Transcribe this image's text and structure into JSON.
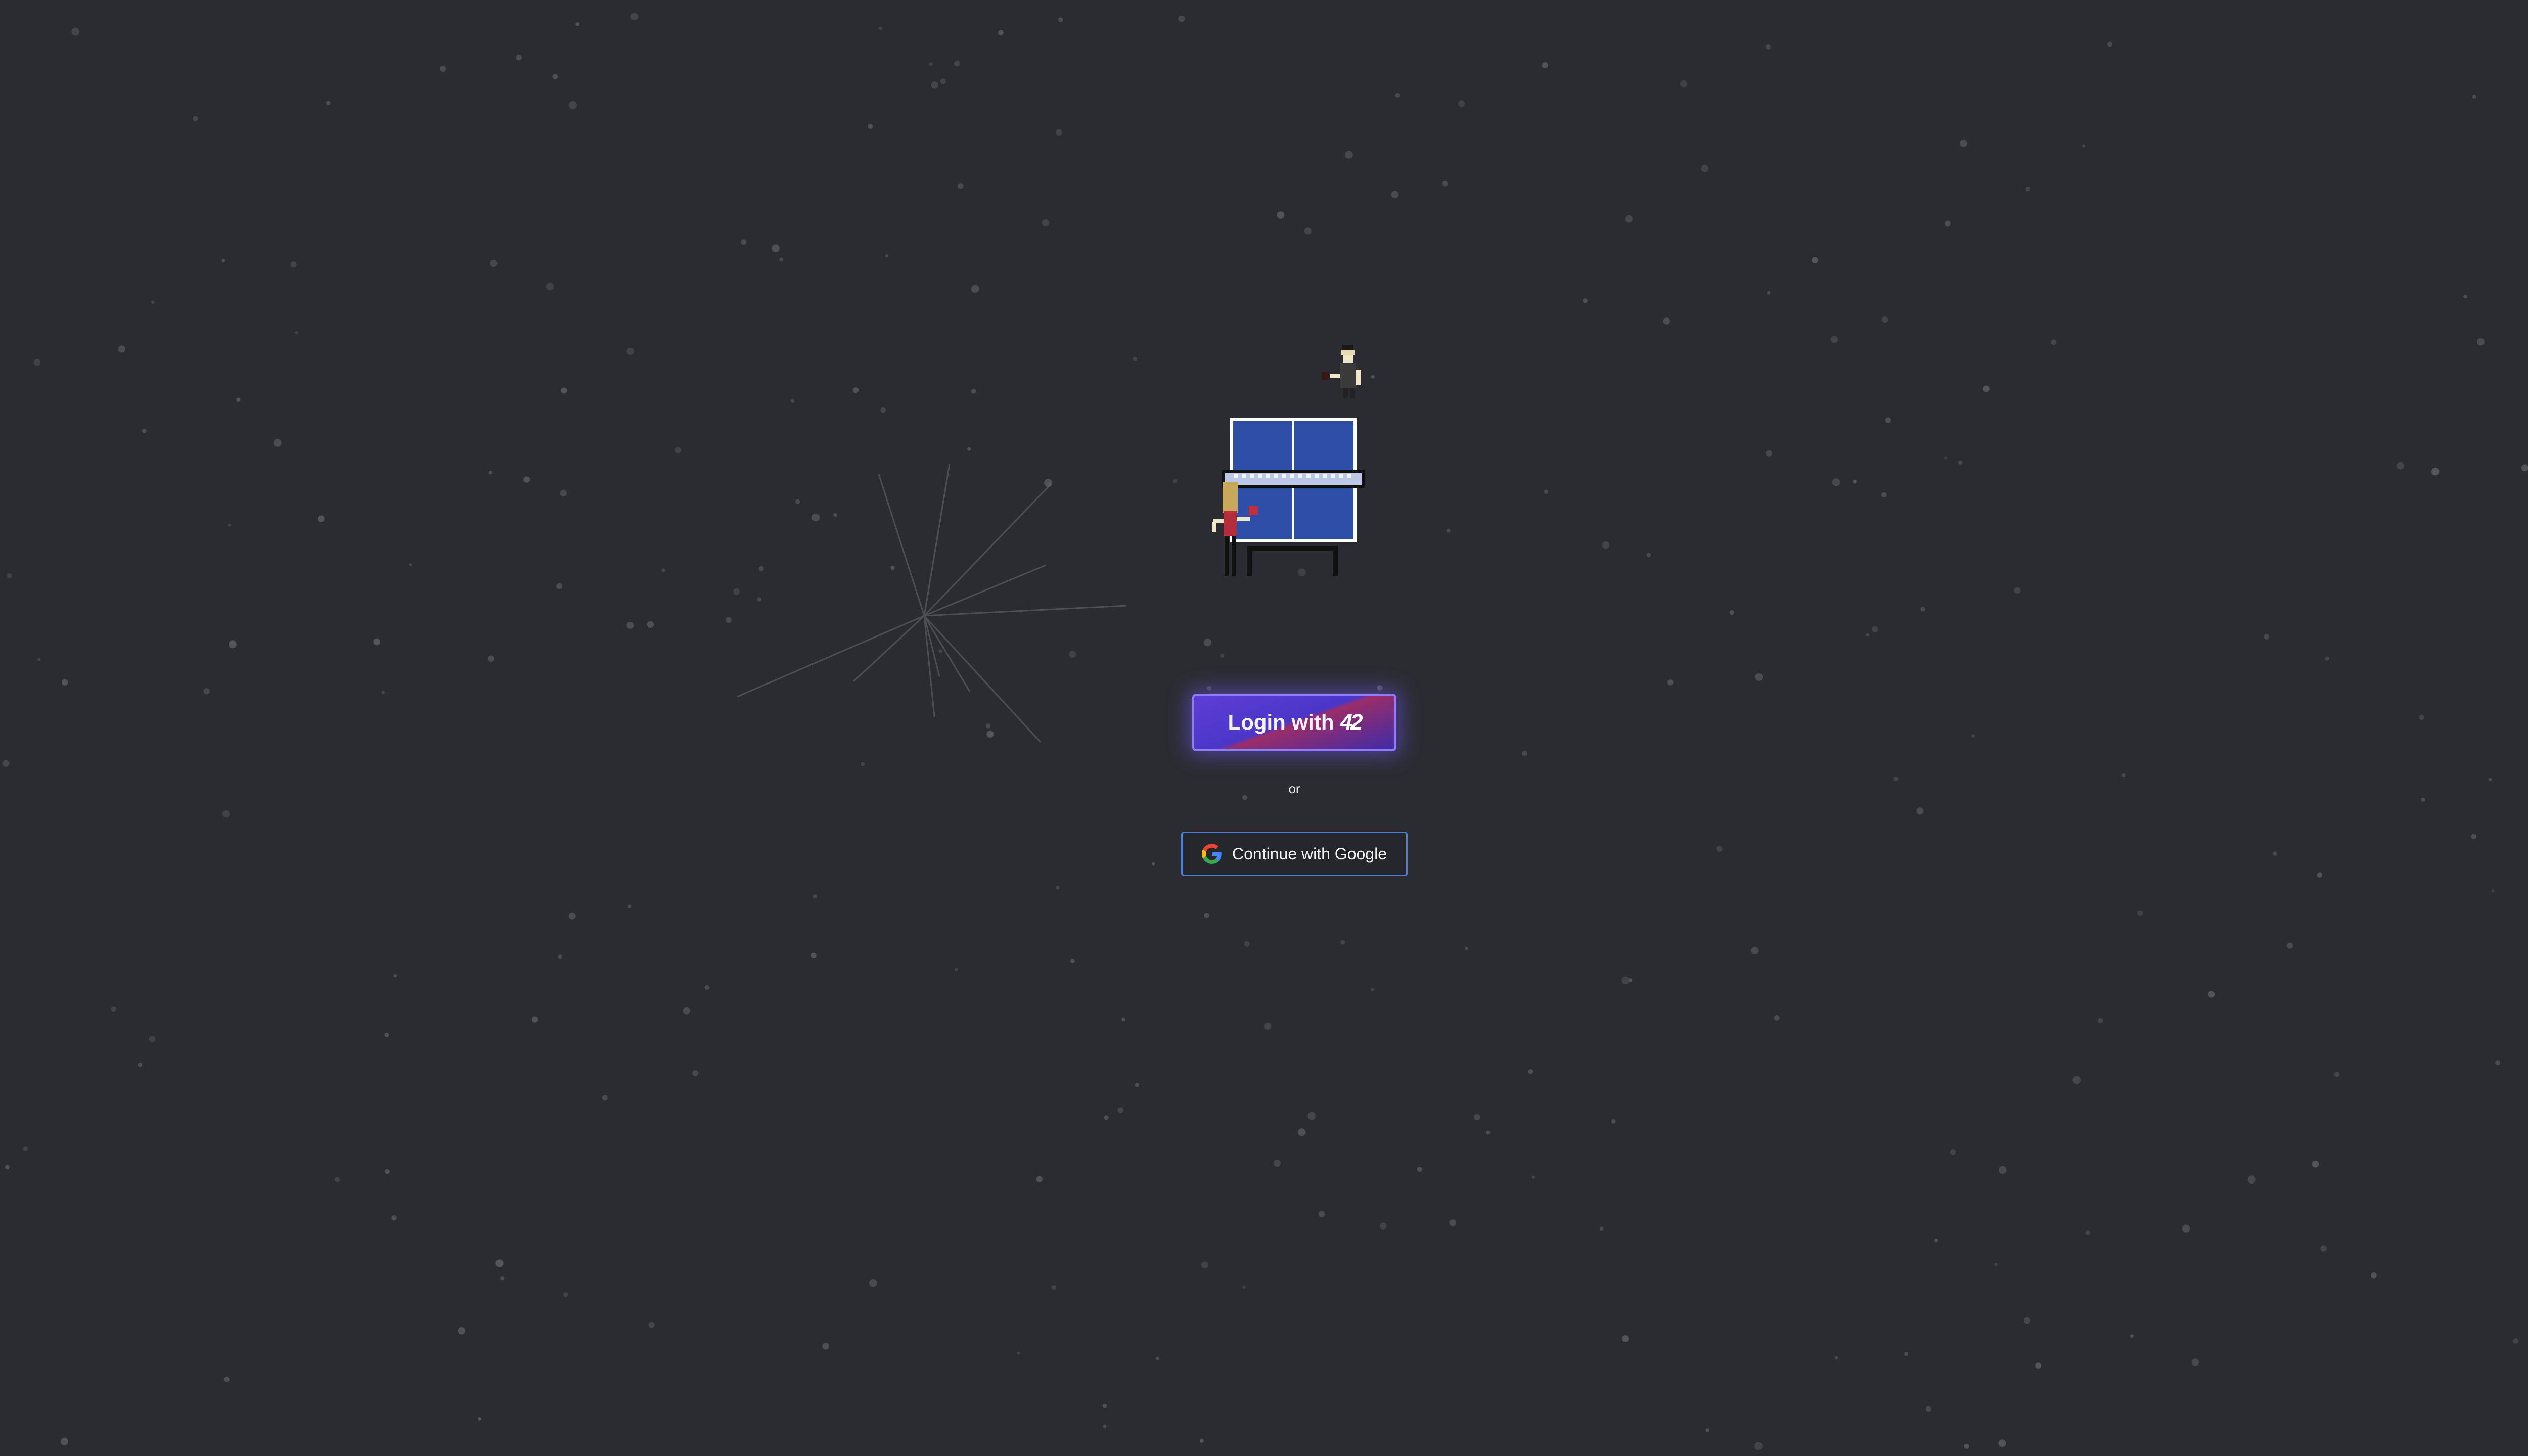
{
  "login": {
    "primary_label": "Login with",
    "primary_logo_text": "42",
    "separator": "or",
    "google_label": "Continue with Google"
  },
  "icons": {
    "logo": "42-logo-icon",
    "google": "google-g-icon",
    "illustration": "ping-pong-table-icon"
  },
  "colors": {
    "background": "#2b2c31",
    "star": "#55565c",
    "primary_button": "#5e3ed6",
    "primary_border": "#8e7bff",
    "google_border": "#4a7fe6",
    "table_blue": "#2f4ea8"
  }
}
